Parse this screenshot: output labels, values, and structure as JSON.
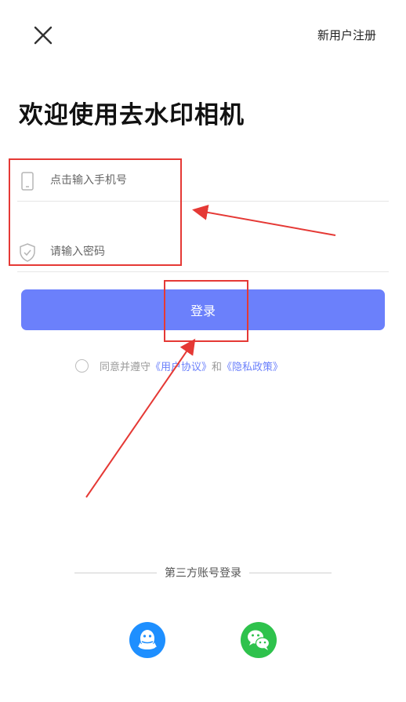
{
  "header": {
    "close_icon": "close-icon",
    "register_label": "新用户注册"
  },
  "main": {
    "title": "欢迎使用去水印相机",
    "phone_field": {
      "placeholder": "点击输入手机号",
      "value": "",
      "icon": "phone-icon"
    },
    "password_field": {
      "placeholder": "请输入密码",
      "value": "",
      "icon": "shield-icon"
    },
    "login_label": "登录",
    "agreement": {
      "prefix": "同意并遵守",
      "user_agreement": "《用户协议》",
      "and": "和",
      "privacy_policy": "《隐私政策》",
      "checked": false
    }
  },
  "third_party": {
    "label": "第三方账号登录",
    "providers": [
      {
        "name": "QQ",
        "icon": "qq-icon",
        "color": "#1e8fff"
      },
      {
        "name": "WeChat",
        "icon": "wechat-icon",
        "color": "#2ec24c"
      }
    ]
  },
  "colors": {
    "accent": "#6b80fb",
    "annotation": "#e53935"
  }
}
